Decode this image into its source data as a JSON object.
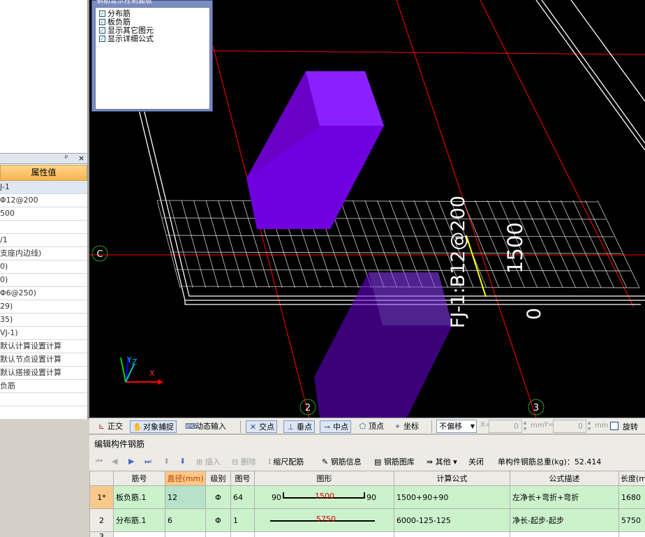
{
  "display_panel": {
    "title": "钢筋显示控制面板",
    "items": [
      {
        "label": "分布筋",
        "checked": true
      },
      {
        "label": "板负筋",
        "checked": true
      },
      {
        "label": "显示其它图元",
        "checked": true
      },
      {
        "label": "显示详细公式",
        "checked": true
      }
    ]
  },
  "properties": {
    "header_pin": "ᵖ",
    "header_close": "×",
    "column_header": "属性值",
    "values": [
      "J-1",
      "Φ12@200",
      "500",
      "",
      "/1",
      "支座内边线)",
      "0)",
      "0)",
      "Φ6@250)",
      "29)",
      "35)",
      "VJ-1)",
      "默认计算设置计算",
      "默认节点设置计算",
      "默认搭接设置计算",
      "负筋",
      "",
      ""
    ]
  },
  "viewport": {
    "axis_labels": {
      "c": "C",
      "two": "2",
      "three": "3"
    },
    "rebar_label": "FJ-1:B12@200",
    "dim_label": "1500",
    "zero_label": "0",
    "axis_y": "Y",
    "axis_z": "Z",
    "axis_x": "X",
    "colors": {
      "component": "#7000e0",
      "grid": "#ff0000",
      "slab": "#ffffff",
      "selected_rebar": "#ffff00"
    }
  },
  "snap_toolbar": {
    "orthogonal": "正交",
    "object_snap": "对象捕捉",
    "dynamic_input": "动态输入",
    "intersection": "交点",
    "perpendicular": "垂点",
    "midpoint": "中点",
    "vertex": "顶点",
    "coordinate": "坐标",
    "offset_mode": "不偏移",
    "x_label": "X=",
    "x_value": "0",
    "y_label": "Y=",
    "y_value": "0",
    "unit": "mm",
    "rotate": "旋转"
  },
  "edit_panel": {
    "title": "编辑构件钢筋",
    "toolbar": {
      "insert": "插入",
      "delete": "删除",
      "scale_rebar": "缩尺配筋",
      "rebar_info": "钢筋信息",
      "rebar_library": "钢筋图库",
      "other": "其他",
      "close": "关闭"
    },
    "total_weight": "单构件钢筋总重(kg)：52.414"
  },
  "rebar_table": {
    "headers": [
      "",
      "筋号",
      "直径(mm)",
      "级别",
      "图号",
      "图形",
      "计算公式",
      "公式描述",
      "长度(m"
    ],
    "rows": [
      {
        "row": "1*",
        "name": "板负筋.1",
        "diameter": "12",
        "grade": "Φ",
        "shape_no": "64",
        "shape_left": "90",
        "shape_mid": "1500",
        "shape_right": "90",
        "formula": "1500+90+90",
        "desc": "左净长+弯折+弯折",
        "length": "1680"
      },
      {
        "row": "2",
        "name": "分布筋.1",
        "diameter": "6",
        "grade": "Φ",
        "shape_no": "1",
        "shape_left": "",
        "shape_mid": "5750",
        "shape_right": "",
        "formula": "6000-125-125",
        "desc": "净长-起步-起步",
        "length": "5750"
      },
      {
        "row": "3",
        "name": "",
        "diameter": "",
        "grade": "",
        "shape_no": "",
        "shape_left": "",
        "shape_mid": "",
        "shape_right": "",
        "formula": "",
        "desc": "",
        "length": ""
      }
    ]
  }
}
